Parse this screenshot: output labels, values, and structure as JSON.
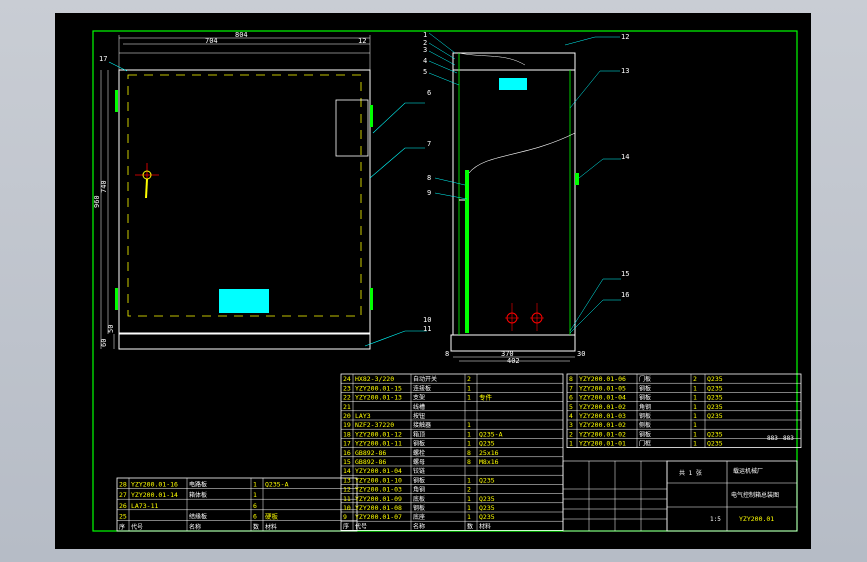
{
  "colors": {
    "background": "#000000",
    "frame": "#00ff00",
    "outline": "#ffffff",
    "hidden": "#ffff00",
    "highlight": "#00ffff",
    "center": "#ff0000",
    "leader": "#00ffff"
  },
  "front_view": {
    "dims": {
      "overall_width": "804",
      "inner_width": "704",
      "top_offset": "12",
      "total_height": "960",
      "body_height": "740",
      "base_left": "60",
      "base_right": "50"
    },
    "leader_labels": [
      "17",
      "6",
      "7",
      "10",
      "11"
    ]
  },
  "side_view": {
    "dims": {
      "bottom_width": "370",
      "total_width": "402",
      "right_offset": "30",
      "left_offset": "8"
    },
    "leader_labels": [
      "1",
      "2",
      "3",
      "4",
      "5",
      "12",
      "13",
      "8",
      "9",
      "14",
      "15",
      "16"
    ]
  },
  "bom_left": [
    [
      "28",
      "YZY200.01-16",
      "电路板",
      "1",
      "Q235-A"
    ],
    [
      "27",
      "YZY200.01-14",
      "箱体板",
      "1",
      ""
    ],
    [
      "26",
      "LA73-11",
      "",
      "6",
      ""
    ],
    [
      "25",
      "",
      "结缘板",
      "6",
      "硬板"
    ],
    [
      "序",
      "代号",
      "名称",
      "数",
      "材料"
    ]
  ],
  "bom_middle": [
    [
      "24",
      "HX82-3/220",
      "自动开关",
      "2",
      ""
    ],
    [
      "23",
      "YZY200.01-15",
      "连接板",
      "1",
      ""
    ],
    [
      "22",
      "YZY200.01-13",
      "支架",
      "1",
      "专件"
    ],
    [
      "21",
      "",
      "线槽",
      "",
      ""
    ],
    [
      "20",
      "LAY3",
      "按钮",
      "",
      ""
    ],
    [
      "19",
      "NZF2-37220",
      "接触器",
      "1",
      ""
    ],
    [
      "18",
      "YZY200.01-12",
      "箱顶",
      "1",
      "Q235-A"
    ],
    [
      "17",
      "YZY200.01-11",
      "钢板",
      "1",
      "Q235"
    ],
    [
      "16",
      "GB892-86",
      "螺栓",
      "8",
      "25x16"
    ],
    [
      "15",
      "GB892-86",
      "螺母",
      "8",
      "M8x16"
    ],
    [
      "14",
      "YZY200.01-04",
      "铰链",
      "",
      ""
    ],
    [
      "13",
      "YZY200.01-10",
      "钢板",
      "1",
      "Q235"
    ],
    [
      "12",
      "YZY200.01-03",
      "角钢",
      "2",
      ""
    ],
    [
      "11",
      "YZY200.01-09",
      "底板",
      "1",
      "Q235"
    ],
    [
      "10",
      "YZY200.01-08",
      "钢板",
      "1",
      "Q235"
    ],
    [
      "9",
      "YZY200.01-07",
      "底座",
      "1",
      "Q235"
    ],
    [
      "序",
      "代号",
      "名称",
      "数",
      "材料"
    ]
  ],
  "bom_right": [
    [
      "8",
      "YZY200.01-06",
      "门板",
      "2",
      "Q235"
    ],
    [
      "7",
      "YZY200.01-05",
      "钢板",
      "1",
      "Q235"
    ],
    [
      "6",
      "YZY200.01-04",
      "钢板",
      "1",
      "Q235"
    ],
    [
      "5",
      "YZY200.01-02",
      "角钢",
      "1",
      "Q235"
    ],
    [
      "4",
      "YZY200.01-03",
      "钢板",
      "1",
      "Q235"
    ],
    [
      "3",
      "YZY200.01-02",
      "侧板",
      "1",
      ""
    ],
    [
      "2",
      "YZY200.01-02",
      "钢板",
      "1",
      "Q235"
    ],
    [
      "1",
      "YZY200.01-01",
      "门框",
      "1",
      "Q235"
    ]
  ],
  "title_block": {
    "company": "载运机械厂",
    "drawing_name": "电气控制箱总装图",
    "drawing_no": "YZY200.01",
    "scale": "1:5",
    "sheet": "共 1 张",
    "qty_labels": [
      "883",
      "883"
    ]
  }
}
